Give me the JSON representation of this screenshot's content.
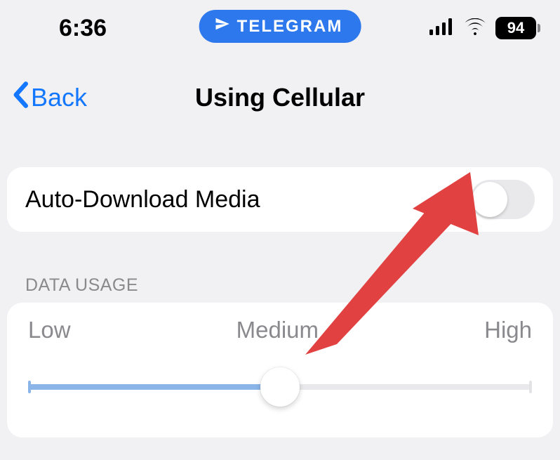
{
  "status": {
    "time": "6:36",
    "pill_label": "TELEGRAM",
    "battery": "94"
  },
  "nav": {
    "back_label": "Back",
    "title": "Using Cellular"
  },
  "cells": {
    "auto_download": {
      "label": "Auto-Download Media",
      "enabled": false
    }
  },
  "sections": {
    "data_usage_header": "DATA USAGE"
  },
  "slider": {
    "low": "Low",
    "medium": "Medium",
    "high": "High",
    "position_percent": 50
  },
  "colors": {
    "link": "#1477ff",
    "pill": "#2d78ed",
    "slider_fill": "#8bb5e8",
    "bg": "#f1f1f3",
    "arrow": "#e03b3b"
  }
}
